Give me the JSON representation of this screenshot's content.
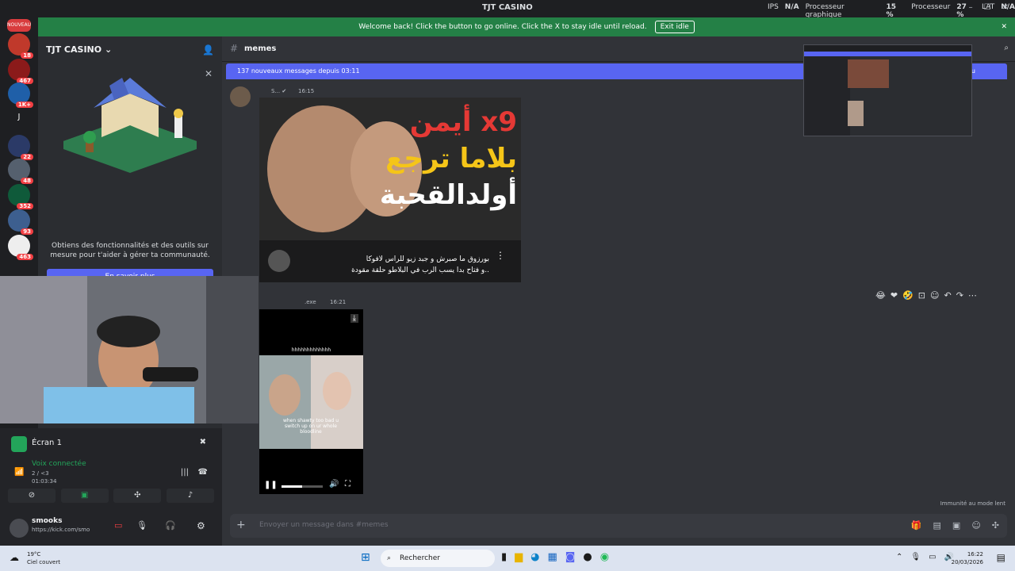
{
  "window": {
    "title": "TJT CASINO",
    "stats": [
      "IPS",
      "N/A",
      "Processeur graphique",
      "15 %",
      "Processeur",
      "27 %",
      "LAT",
      "N/A"
    ]
  },
  "banner": {
    "text": "Welcome back! Click the button to go online. Click the X to stay idle until reload.",
    "button": "Exit idle"
  },
  "rail": {
    "badges": [
      "NOUVEAU",
      "18",
      "467",
      "1K+",
      "22",
      "48",
      "352",
      "93",
      "463"
    ],
    "letter": "J"
  },
  "sidebar": {
    "server_name": "TJT CASINO",
    "promo_text": "Obtiens des fonctionnalités et des outils sur mesure pour t'aider à gérer ta communauté.",
    "promo_button": "En savoir plus"
  },
  "voice": {
    "screen_title": "Écran 1",
    "connected": "Voix connectée",
    "channel": "2 / <3",
    "timer": "01:03:34",
    "username": "smooks",
    "status": "https://kick.com/smo"
  },
  "header": {
    "channel": "memes"
  },
  "new_messages": {
    "text": "137 nouveaux messages depuis 03:11",
    "mark_read": "lu"
  },
  "messages": [
    {
      "time": "16:15",
      "caption_line1": "بورزوق ما صبرش و جبد زيو للراس لافوكا",
      "caption_line2": "و فتاح بدا يسب الرب في البلاطو حلقة مقودة.. ",
      "title_ar": [
        "أيمن x9",
        "بلاما ترجع",
        "أولدالقحبة"
      ]
    },
    {
      "author_tag": ".exe",
      "time": "16:21",
      "video_title": "hhhhhhhhhhhhh",
      "video_caption": "when shawty too bad u switch up on ur whole bloodline"
    }
  ],
  "composer": {
    "placeholder": "Envoyer un message dans #memes"
  },
  "slowmode": "Immunité au mode lent",
  "taskbar": {
    "weather_temp": "19°C",
    "weather_desc": "Ciel couvert",
    "search": "Rechercher",
    "time": "16:22",
    "date": "20/03/2026"
  }
}
